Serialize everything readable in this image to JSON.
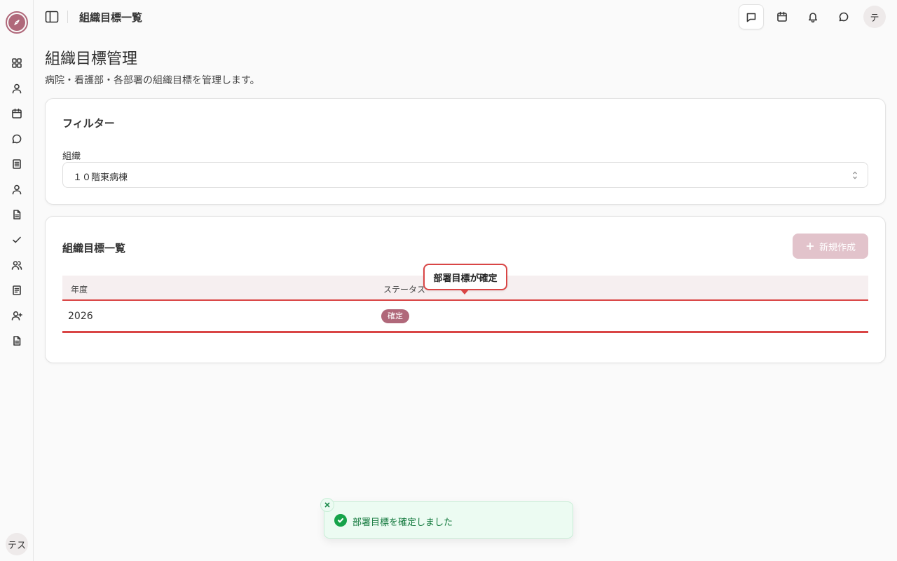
{
  "topbar": {
    "title": "組織目標一覧",
    "avatar_initial": "テ"
  },
  "sidebar": {
    "avatar_initials": "テス",
    "items": [
      {
        "icon": "dashboard-icon"
      },
      {
        "icon": "user-icon"
      },
      {
        "icon": "calendar-icon"
      },
      {
        "icon": "chat-icon"
      },
      {
        "icon": "document-icon"
      },
      {
        "icon": "profile-icon"
      },
      {
        "icon": "file-icon"
      },
      {
        "icon": "check-icon"
      },
      {
        "icon": "users-icon"
      },
      {
        "icon": "notes-icon"
      },
      {
        "icon": "user-plus-icon"
      },
      {
        "icon": "report-icon"
      }
    ]
  },
  "page": {
    "title": "組織目標管理",
    "subtitle": "病院・看護部・各部署の組織目標を管理します。"
  },
  "filter": {
    "card_title": "フィルター",
    "org_label": "組織",
    "org_value": "１０階東病棟"
  },
  "list": {
    "card_title": "組織目標一覧",
    "new_button": "新規作成",
    "columns": [
      "年度",
      "ステータス"
    ],
    "rows": [
      {
        "year": "2026",
        "status": "確定"
      }
    ]
  },
  "callout": {
    "text": "部署目標が確定"
  },
  "toast": {
    "message": "部署目標を確定しました"
  },
  "colors": {
    "accent": "#b0687a",
    "accent_light": "#e2c3cb",
    "highlight": "#d94545",
    "success": "#16a34a"
  }
}
